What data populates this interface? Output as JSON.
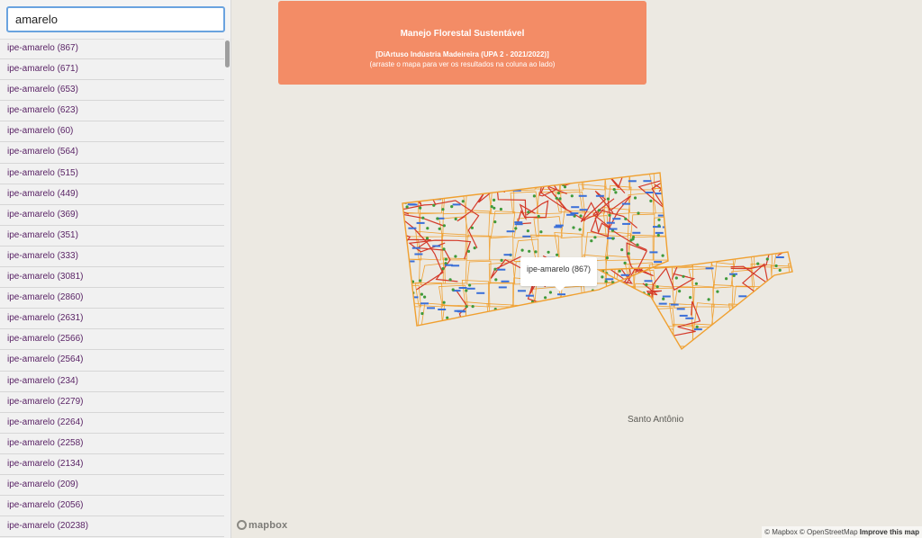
{
  "search": {
    "value": "amarelo"
  },
  "results": [
    "ipe-amarelo (867)",
    "ipe-amarelo (671)",
    "ipe-amarelo (653)",
    "ipe-amarelo (623)",
    "ipe-amarelo (60)",
    "ipe-amarelo (564)",
    "ipe-amarelo (515)",
    "ipe-amarelo (449)",
    "ipe-amarelo (369)",
    "ipe-amarelo (351)",
    "ipe-amarelo (333)",
    "ipe-amarelo (3081)",
    "ipe-amarelo (2860)",
    "ipe-amarelo (2631)",
    "ipe-amarelo (2566)",
    "ipe-amarelo (2564)",
    "ipe-amarelo (234)",
    "ipe-amarelo (2279)",
    "ipe-amarelo (2264)",
    "ipe-amarelo (2258)",
    "ipe-amarelo (2134)",
    "ipe-amarelo (209)",
    "ipe-amarelo (2056)",
    "ipe-amarelo (20238)"
  ],
  "banner": {
    "title": "Manejo Florestal Sustentável",
    "subtitle": "[DiArtuso Indústria Madeireira (UPA 2 - 2021/2022)]",
    "hint": "(arraste o mapa para ver os resultados na coluna ao lado)"
  },
  "popup": {
    "label": "ipe-amarelo (867)"
  },
  "map": {
    "place_label": "Santo Antônio"
  },
  "logo": {
    "text": "mapbox"
  },
  "attribution": {
    "mapbox": "© Mapbox",
    "osm": "© OpenStreetMap",
    "improve": "Improve this map"
  },
  "colors": {
    "banner": "#f38c66",
    "parcel_outline": "#f0a030",
    "roads": "#d43a2a",
    "trees": "#3f9a3a",
    "labels": "#3a6fd8"
  }
}
